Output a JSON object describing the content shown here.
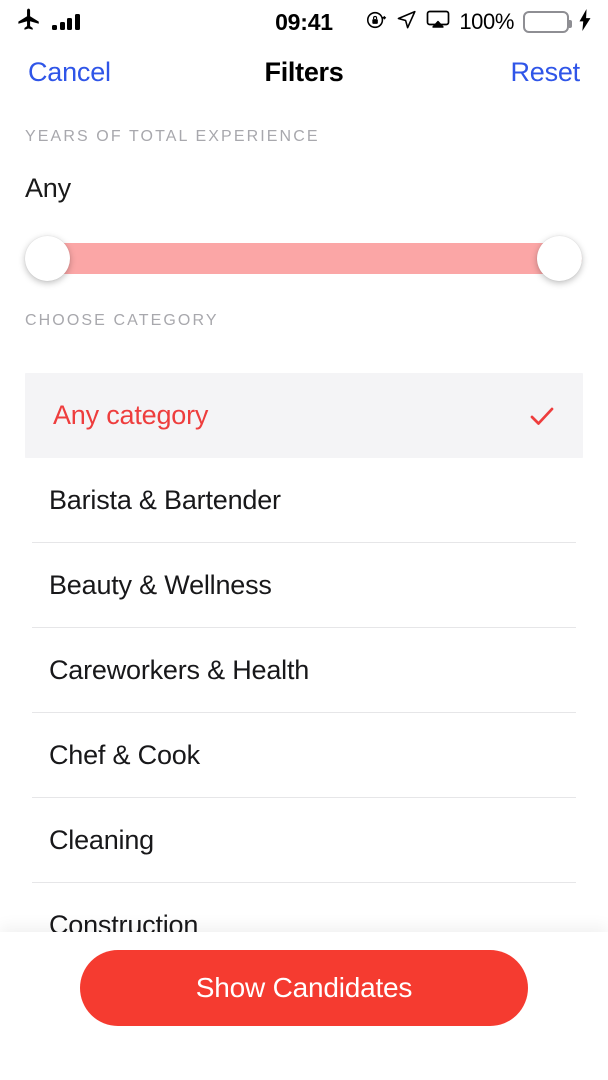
{
  "status_bar": {
    "airplane_icon": "airplane-icon",
    "signal_icon": "signal-bars-icon",
    "time": "09:41",
    "rotation_lock_icon": "rotation-lock-icon",
    "location_icon": "location-arrow-icon",
    "airplay_icon": "airplay-icon",
    "battery_percent": "100%",
    "charging_icon": "lightning-bolt-icon",
    "battery_color": "#3ad353"
  },
  "nav_bar": {
    "cancel_label": "Cancel",
    "title": "Filters",
    "reset_label": "Reset",
    "link_color": "#2f55e8"
  },
  "experience": {
    "header": "YEARS OF TOTAL EXPERIENCE",
    "value": "Any",
    "slider": {
      "track_color": "#fba6a6",
      "min_thumb": "range-slider-min-thumb",
      "max_thumb": "range-slider-max-thumb"
    }
  },
  "category": {
    "header": "CHOOSE CATEGORY",
    "selected_color": "#ee3d3d",
    "selected_background": "#f4f4f6",
    "items": [
      {
        "label": "Any category",
        "selected": true
      },
      {
        "label": "Barista & Bartender",
        "selected": false
      },
      {
        "label": "Beauty & Wellness",
        "selected": false
      },
      {
        "label": "Careworkers & Health",
        "selected": false
      },
      {
        "label": "Chef & Cook",
        "selected": false
      },
      {
        "label": "Cleaning",
        "selected": false
      },
      {
        "label": "Construction",
        "selected": false
      }
    ]
  },
  "bottom_bar": {
    "button_label": "Show Candidates",
    "button_color": "#f53b30"
  }
}
